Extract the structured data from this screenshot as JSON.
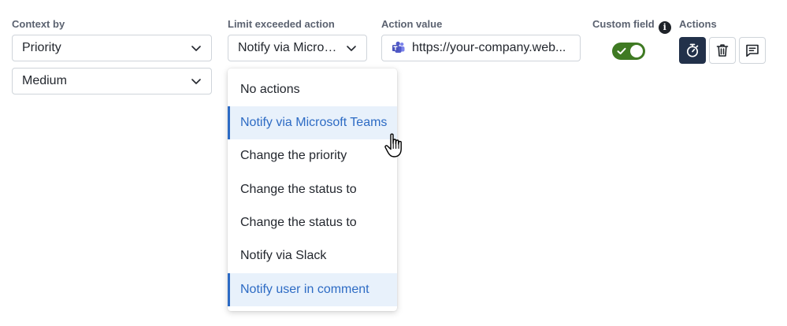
{
  "labels": {
    "context_by": "Context by",
    "limit_action": "Limit exceeded action",
    "action_value": "Action value",
    "custom_field": "Custom field",
    "actions": "Actions"
  },
  "context": {
    "priority_value": "Priority",
    "level_value": "Medium"
  },
  "limit_action": {
    "selected": "Notify via Micros...",
    "options": [
      {
        "label": "No actions",
        "selected": false
      },
      {
        "label": "Notify via Microsoft Teams",
        "selected": true
      },
      {
        "label": "Change the priority",
        "selected": false
      },
      {
        "label": "Change the status to",
        "selected": false
      },
      {
        "label": "Change the status to",
        "selected": false
      },
      {
        "label": "Notify via Slack",
        "selected": false
      },
      {
        "label": "Notify user in comment",
        "selected": true
      }
    ]
  },
  "action_value": {
    "url": "https://your-company.web...",
    "icon": "microsoft-teams-icon"
  },
  "custom_field": {
    "enabled": true,
    "info_glyph": "i"
  },
  "actions": {
    "buttons": [
      "timer-icon",
      "trash-icon",
      "comment-icon"
    ]
  },
  "colors": {
    "toggle_on": "#3f7a23",
    "primary_button": "#22314a",
    "selected_text": "#2d6bc4",
    "selected_bg": "#e8f1fb"
  }
}
